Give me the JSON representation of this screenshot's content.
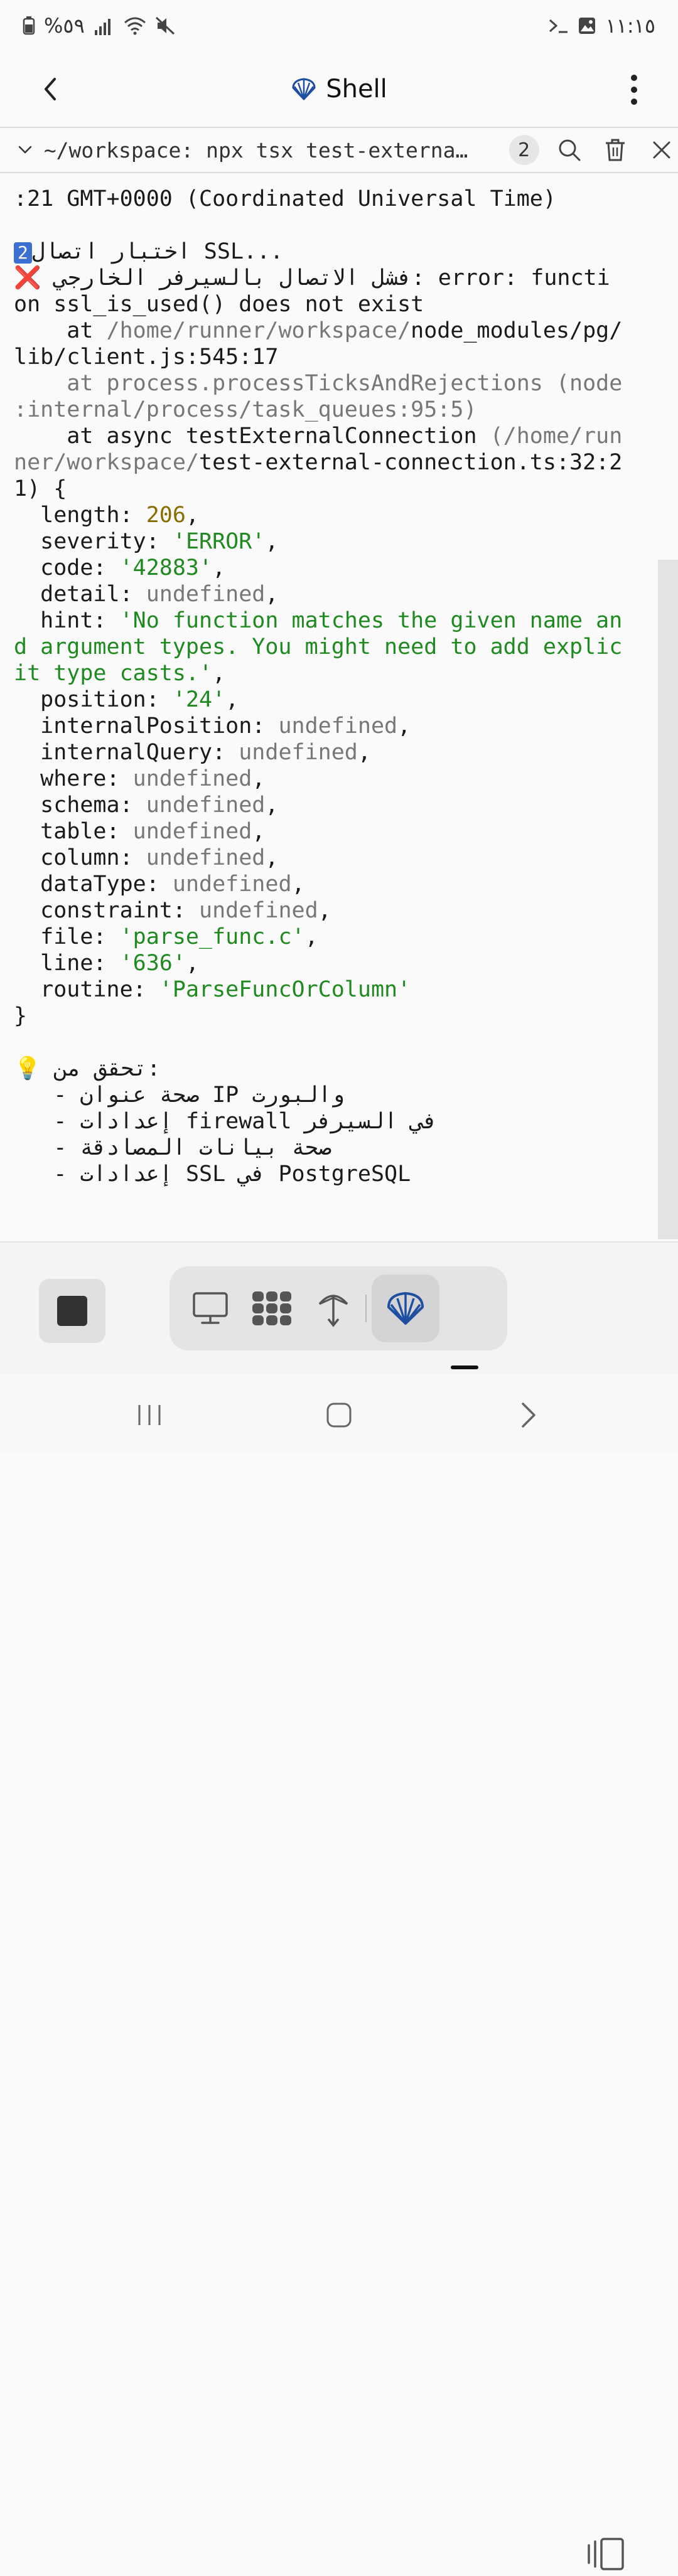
{
  "status_bar": {
    "battery": "%٥٩",
    "time": "١١:١٥"
  },
  "header": {
    "title": "Shell"
  },
  "tab": {
    "title": "~/workspace: npx tsx test-externa…",
    "count": "2"
  },
  "terminal": {
    "line_01": ":21 GMT+0000 (Coordinated Universal Time)",
    "line_02": "",
    "line_03_badge": "2",
    "line_03_text": "اختبار اتصال SSL...",
    "line_04_icon": "❌",
    "line_04_text": " فشل الاتصال بالسيرفر الخارجي: error: functi",
    "line_05": "on ssl_is_used() does not exist",
    "line_06_a": "    at ",
    "line_06_b": "/home/runner/workspace/",
    "line_06_c": "node_modules/pg/",
    "line_07": "lib/client.js:545:17",
    "line_08": "    at process.processTicksAndRejections (node",
    "line_09": ":internal/process/task_queues:95:5)",
    "line_10_a": "    at async testExternalConnection ",
    "line_10_b": "(/home/run",
    "line_11_a": "ner/workspace/",
    "line_11_b": "test-external-connection.ts:32:2",
    "line_12": "1) {",
    "line_13_key": "  length: ",
    "line_13_val": "206",
    "line_14_key": "  severity: ",
    "line_14_val": "'ERROR'",
    "line_15_key": "  code: ",
    "line_15_val": "'42883'",
    "line_16_key": "  detail: ",
    "line_16_val": "undefined",
    "line_17_key": "  hint: ",
    "line_17_val": "'No function matches the given name an",
    "line_18": "d argument types. You might need to add explic",
    "line_19": "it type casts.'",
    "line_20_key": "  position: ",
    "line_20_val": "'24'",
    "line_21_key": "  internalPosition: ",
    "line_21_val": "undefined",
    "line_22_key": "  internalQuery: ",
    "line_22_val": "undefined",
    "line_23_key": "  where: ",
    "line_23_val": "undefined",
    "line_24_key": "  schema: ",
    "line_24_val": "undefined",
    "line_25_key": "  table: ",
    "line_25_val": "undefined",
    "line_26_key": "  column: ",
    "line_26_val": "undefined",
    "line_27_key": "  dataType: ",
    "line_27_val": "undefined",
    "line_28_key": "  constraint: ",
    "line_28_val": "undefined",
    "line_29_key": "  file: ",
    "line_29_val": "'parse_func.c'",
    "line_30_key": "  line: ",
    "line_30_val": "'636'",
    "line_31_key": "  routine: ",
    "line_31_val": "'ParseFuncOrColumn'",
    "line_32": "}",
    "line_33": "",
    "line_34_icon": "💡",
    "line_34_text": " تحقق من:",
    "line_35": "   - صحة عنوان IP والبورت",
    "line_36": "   - إعدادات firewall في السيرفر",
    "line_37": "   - صحة بيانات المصادقة",
    "line_38": "   - إعدادات SSL في PostgreSQL"
  },
  "icons": {
    "back": "chevron-left-icon",
    "more": "vertical-dots-icon",
    "shell": "shell-icon",
    "search": "search-icon",
    "trash": "trash-icon",
    "close": "close-icon"
  },
  "colors": {
    "accent": "#1f4fa0",
    "string": "#1f8a1f",
    "number": "#8a6d00",
    "undefined": "#777777",
    "error": "#dd1111"
  }
}
